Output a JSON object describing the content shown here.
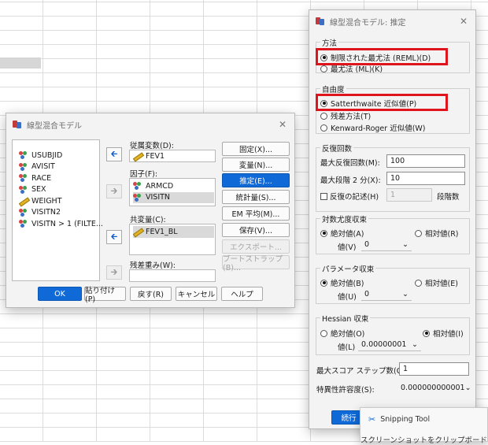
{
  "main_dialog": {
    "title": "線型混合モデル",
    "variables": [
      {
        "label": "USUBJID",
        "type": "nominal"
      },
      {
        "label": "AVISIT",
        "type": "nominal"
      },
      {
        "label": "RACE",
        "type": "nominal"
      },
      {
        "label": "SEX",
        "type": "nominal"
      },
      {
        "label": "WEIGHT",
        "type": "scale"
      },
      {
        "label": "VISITN2",
        "type": "nominal"
      },
      {
        "label": "VISITN > 1 (FILTE...",
        "type": "nominal"
      }
    ],
    "dependent_label": "従属変数(D):",
    "dependent_value": "FEV1",
    "factor_label": "因子(F):",
    "factors": [
      "ARMCD",
      "VISITN"
    ],
    "covariate_label": "共変量(C):",
    "covariate_value": "FEV1_BL",
    "residual_weight_label": "残差重み(W):",
    "side_buttons": {
      "fixed": "固定(X)...",
      "random": "変量(N)...",
      "estimation": "推定(E)...",
      "statistics": "統計量(S)...",
      "em_means": "EM 平均(M)...",
      "save": "保存(V)...",
      "export": "エクスポート...",
      "bootstrap": "ブートストラップ(B)..."
    },
    "footer_buttons": {
      "ok": "OK",
      "paste": "貼り付け(P)",
      "reset": "戻す(R)",
      "cancel": "キャンセル",
      "help": "ヘルプ"
    }
  },
  "estimation_dialog": {
    "title": "線型混合モデル: 推定",
    "method": {
      "title": "方法",
      "options": [
        "制限された最尤法 (REML)(D)",
        "最尤法 (ML)(K)"
      ],
      "selected": 0
    },
    "df": {
      "title": "自由度",
      "options": [
        "Satterthwaite 近似値(P)",
        "残差方法(T)",
        "Kenward-Roger 近似値(W)"
      ],
      "selected": 0
    },
    "iterations": {
      "title": "反復回数",
      "max_iter_label": "最大反復回数(M):",
      "max_iter_value": "100",
      "max_step_label": "最大段階 2 分(X):",
      "max_step_value": "10",
      "print_label": "反復の記述(H)",
      "print_value": "1",
      "steps_label": "段階数"
    },
    "loglik": {
      "title": "対数尤度収束",
      "abs_label": "絶対値(A)",
      "rel_label": "相対値(R)",
      "value_label": "値(V)",
      "value": "0"
    },
    "param": {
      "title": "パラメータ収束",
      "abs_label": "絶対値(B)",
      "rel_label": "相対値(E)",
      "value_label": "値(U)",
      "value": "0"
    },
    "hessian": {
      "title": "Hessian 収束",
      "abs_label": "絶対値(O)",
      "rel_label": "相対値(I)",
      "value_label": "値(L)",
      "value": "0.00000001"
    },
    "max_scoring_label": "最大スコア ステップ数(G):",
    "max_scoring_value": "1",
    "singularity_label": "特異性許容度(S):",
    "singularity_value": "0.000000000001",
    "continue_button": "続行"
  },
  "snipping_tool": {
    "title": "Snipping Tool",
    "message": "スクリーンショットをクリップボードにコピー"
  }
}
